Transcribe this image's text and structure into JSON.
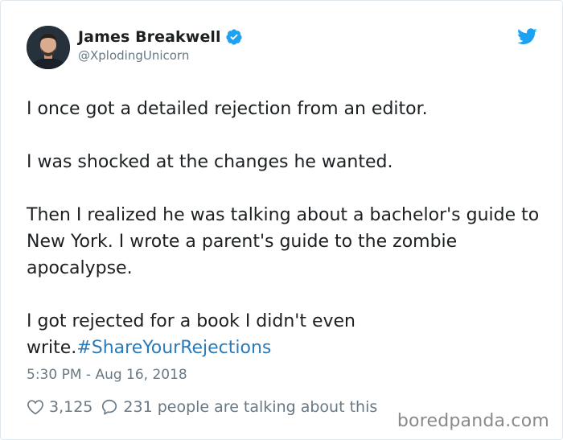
{
  "author": {
    "display_name": "James Breakwell",
    "handle": "@XplodingUnicorn",
    "verified": true
  },
  "tweet": {
    "paragraphs": [
      "I once got a detailed rejection from an editor.",
      "I was shocked at the changes he wanted.",
      "Then I realized he was talking about a bachelor's guide to New York. I wrote a parent's guide to the zombie apocalypse.",
      "I got rejected for a book I didn't even write."
    ],
    "hashtag": "#ShareYourRejections",
    "timestamp": "5:30 PM - Aug 16, 2018"
  },
  "engagement": {
    "likes": "3,125",
    "replies_text": "231 people are talking about this"
  },
  "icons": {
    "verified": "verified-badge-icon",
    "brand": "twitter-bird-icon",
    "like": "heart-icon",
    "reply": "speech-bubble-icon"
  },
  "colors": {
    "link": "#2b7bb9",
    "twitter_blue": "#1da1f2",
    "secondary_text": "#697882"
  },
  "watermark": "boredpanda.com"
}
